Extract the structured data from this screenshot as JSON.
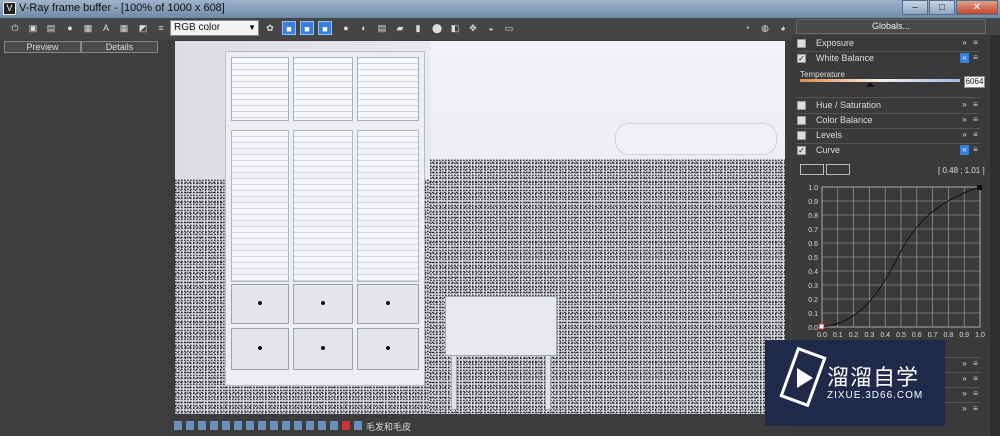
{
  "window": {
    "title": "V-Ray frame buffer - [100% of 1000 x 608]",
    "buttons": [
      "–",
      "□",
      "✕"
    ]
  },
  "toolbar": {
    "channel_select": "RGB color"
  },
  "left_panel": {
    "tabs": [
      "Preview",
      "Details"
    ]
  },
  "right_panel": {
    "globals_label": "Globals...",
    "sections": [
      {
        "label": "Exposure",
        "checked": false,
        "expanded": false
      },
      {
        "label": "White Balance",
        "checked": true,
        "expanded": true
      },
      {
        "label": "Hue / Saturation",
        "checked": false,
        "expanded": false
      },
      {
        "label": "Color Balance",
        "checked": false,
        "expanded": false
      },
      {
        "label": "Levels",
        "checked": false,
        "expanded": false
      },
      {
        "label": "Curve",
        "checked": true,
        "expanded": true
      }
    ],
    "white_balance": {
      "temperature_label": "Temperature",
      "temperature_value": "6064"
    },
    "curve": {
      "coords": "[ 0.48 ; 1.01 ]",
      "y_ticks": [
        "1.0",
        "0.9",
        "0.8",
        "0.7",
        "0.6",
        "0.5",
        "0.4",
        "0.3",
        "0.2",
        "0.1",
        "0.0"
      ],
      "x_ticks": [
        "0.0",
        "0.1",
        "0.2",
        "0.3",
        "0.4",
        "0.5",
        "0.6",
        "0.7",
        "0.8",
        "0.9",
        "1.0"
      ]
    }
  },
  "statusbar": {
    "text": "毛发和毛皮"
  },
  "watermark": {
    "brand_cn": "溜溜自学",
    "url": "ZIXUE.3D66.COM"
  }
}
